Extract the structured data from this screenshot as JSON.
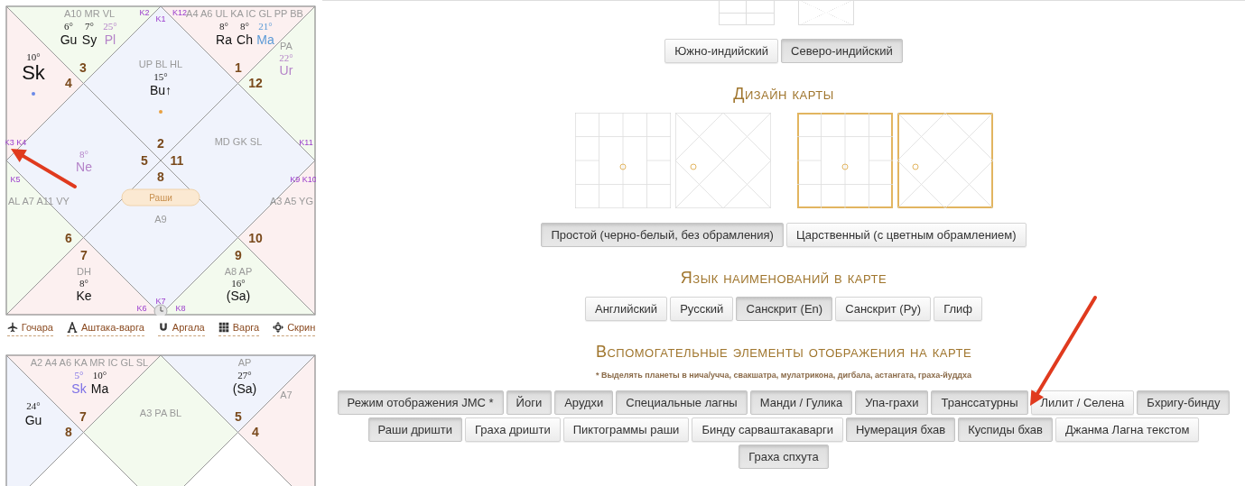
{
  "charts": [
    {
      "center_label": "Раши",
      "houses": [
        {
          "kind": "top-left",
          "color": "#f3faee",
          "sign": "3",
          "arudhas": "A10 MR VL",
          "planets": [
            {
              "degree": "6°",
              "name": "Gu"
            },
            {
              "degree": "7°",
              "name": "Sy"
            },
            {
              "degree": "25°",
              "name": "Pl",
              "color": "#b482c8"
            }
          ]
        },
        {
          "kind": "top-right",
          "color": "#fcf0f0",
          "sign": "1",
          "arudhas": "A4 A6 UL KA IC GL PP BB",
          "planets": [
            {
              "degree": "8°",
              "name": "Ra"
            },
            {
              "degree": "8°",
              "name": "Ch"
            },
            {
              "degree": "21°",
              "name": "Ma",
              "color": "#5b9ad6"
            }
          ]
        },
        {
          "kind": "left-top",
          "color": "#fcf0f0",
          "sign": "4",
          "planets": [
            {
              "kind": "large",
              "degree": "10°",
              "name": "Sk"
            }
          ],
          "dot": {
            "color": "#6a8ae8"
          }
        },
        {
          "kind": "right-top",
          "color": "#f3faee",
          "sign": "12",
          "arudhas": "PA",
          "planets": [
            {
              "degree": "22°",
              "name": "Ur",
              "color": "#b482c8"
            }
          ]
        },
        {
          "kind": "top",
          "color": "#f0f3fc",
          "sign": "2",
          "arudhas": "UP BL HL",
          "planets": [
            {
              "degree": "15°",
              "name": "Bu↑"
            }
          ],
          "dot": {
            "color": "#e8a040"
          }
        },
        {
          "kind": "right",
          "color": "#f0f3fc",
          "sign": "11",
          "arudhas": "MD GK SL"
        },
        {
          "kind": "left",
          "color": "#f0f3fc",
          "sign": "5",
          "planets": [
            {
              "degree": "8°",
              "name": "Ne",
              "color": "#b482c8"
            }
          ]
        },
        {
          "kind": "left-bottom",
          "color": "#f3faee",
          "sign": "6",
          "arudhas": "AL A7 A11 VY"
        },
        {
          "kind": "right-bottom",
          "color": "#fcf0f0",
          "sign": "10",
          "arudhas": "A3 A5 YG"
        },
        {
          "kind": "bottom",
          "color": "#f0f3fc",
          "sign": "8",
          "arudhas": "A9"
        },
        {
          "kind": "bottom-left",
          "color": "#fcf0f0",
          "sign": "7",
          "arudhas": "DH",
          "planets": [
            {
              "degree": "8°",
              "name": "Ke"
            }
          ]
        },
        {
          "kind": "bottom-right",
          "color": "#f3faee",
          "sign": "9",
          "arudhas": "A8 AP",
          "planets": [
            {
              "degree": "16°",
              "name": "(Sa)"
            }
          ]
        }
      ],
      "cusps": [
        {
          "label": "K2",
          "kind": "top-left-of-center"
        },
        {
          "label": "K12",
          "kind": "top-right-of-center"
        },
        {
          "label": "K1",
          "kind": "top-center"
        },
        {
          "label": "K3 K4",
          "kind": "left-upper"
        },
        {
          "label": "K11",
          "kind": "right-upper"
        },
        {
          "label": "K5",
          "kind": "left-lower"
        },
        {
          "label": "K9 K10",
          "kind": "right-lower"
        },
        {
          "label": "K7",
          "kind": "bottom-center"
        },
        {
          "label": "K6",
          "kind": "bottom-left-of-center"
        },
        {
          "label": "K8",
          "kind": "bottom-right-of-center"
        }
      ]
    },
    {
      "houses": [
        {
          "kind": "top-left",
          "color": "#fcf0f0",
          "sign": "7",
          "arudhas": "A2 A4 A6 KA MR IC GL SL",
          "planets": [
            {
              "degree": "5°",
              "name": "Sk",
              "color": "#7b6ee6"
            },
            {
              "degree": "10°",
              "name": "Ma"
            }
          ]
        },
        {
          "kind": "top-right",
          "color": "#f0f3fc",
          "sign": "5",
          "arudhas": "AP",
          "planets": [
            {
              "degree": "27°",
              "name": "(Sa)"
            }
          ]
        },
        {
          "kind": "left-top",
          "color": "#f0f3fc",
          "sign": "8",
          "planets": [
            {
              "degree": "24°",
              "name": "Gu"
            }
          ]
        },
        {
          "kind": "top",
          "color": "#f3faee",
          "arudhas": "A3 PA BL"
        },
        {
          "kind": "right-top",
          "color": "#fcf0f0",
          "sign": "4",
          "arudhas": "A7"
        }
      ]
    }
  ],
  "chart_links": [
    {
      "kind": "plane",
      "label": "Гочара"
    },
    {
      "kind": "letter",
      "label": "Аштака-варга"
    },
    {
      "kind": "magnet",
      "label": "Аргала"
    },
    {
      "kind": "grid",
      "label": "Варга"
    },
    {
      "kind": "crosshair",
      "label": "Скрин"
    }
  ],
  "chart_type_buttons": [
    {
      "label": "Южно-индийский",
      "selected": false
    },
    {
      "label": "Северо-индийский",
      "selected": true
    }
  ],
  "design": {
    "title": "Дизайн карты",
    "previews": [
      {
        "kind": "plain-south"
      },
      {
        "kind": "plain-north"
      },
      {
        "kind": "royal-south"
      },
      {
        "kind": "royal-north"
      }
    ],
    "buttons": [
      {
        "label": "Простой (черно-белый, без обрамления)",
        "selected": true
      },
      {
        "label": "Царственный (с цветным обрамлением)",
        "selected": false
      }
    ]
  },
  "language": {
    "title": "Язык наименований в карте",
    "buttons": [
      {
        "label": "Английский",
        "selected": false
      },
      {
        "label": "Русский",
        "selected": false
      },
      {
        "label": "Санскрит (En)",
        "selected": true
      },
      {
        "label": "Санскрит (Ру)",
        "selected": false
      },
      {
        "label": "Глиф",
        "selected": false
      }
    ]
  },
  "elements": {
    "title": "Вспомогательные элементы отображения на карте",
    "note": "* Выделять планеты в нича/учча, свакшатра, мулатрикона, дигбала, астангата, граха-йуддха",
    "buttons": [
      {
        "label": "Режим отображения JMC *",
        "selected": true
      },
      {
        "label": "Йоги",
        "selected": true
      },
      {
        "label": "Арудхи",
        "selected": true
      },
      {
        "label": "Специальные лагны",
        "selected": true
      },
      {
        "label": "Манди / Гулика",
        "selected": true
      },
      {
        "label": "Упа-грахи",
        "selected": true
      },
      {
        "label": "Транссатурны",
        "selected": true
      },
      {
        "label": "Лилит / Селена",
        "selected": false
      },
      {
        "label": "Бхригу-бинду",
        "selected": true
      },
      {
        "label": "Раши дришти",
        "selected": true
      },
      {
        "label": "Граха дришти",
        "selected": false
      },
      {
        "label": "Пиктограммы раши",
        "selected": false
      },
      {
        "label": "Бинду сарваштакаварги",
        "selected": false
      },
      {
        "label": "Нумерация бхав",
        "selected": true
      },
      {
        "label": "Куспиды бхав",
        "selected": true
      },
      {
        "label": "Джанма Лагна текстом",
        "selected": false
      },
      {
        "label": "Граха спхута",
        "selected": true
      }
    ]
  }
}
